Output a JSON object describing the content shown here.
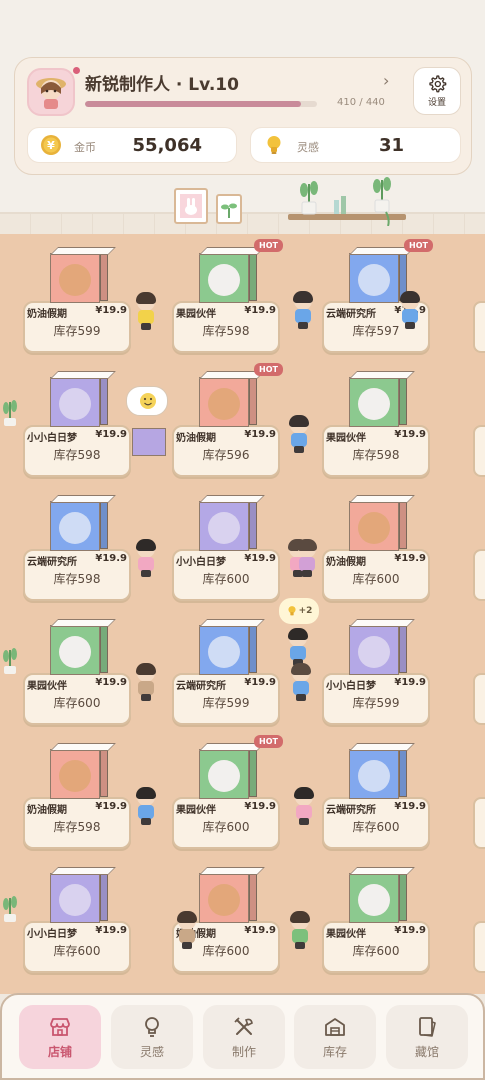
{
  "player": {
    "name": "新锐制作人 · Lv.10",
    "xp_text": "410 / 440",
    "xp_fraction": 0.932
  },
  "settings_label": "设置",
  "stats": {
    "coin_label": "金币",
    "coin_value": "55,064",
    "idea_label": "灵感",
    "idea_value": "31"
  },
  "idea_popup": "+2",
  "stock_prefix": "库存",
  "hot_label": "HOT",
  "colors": {
    "pink": "#f2a99a",
    "purple": "#b4a8e6",
    "green": "#8cc98f",
    "blue": "#82a8ee"
  },
  "shelves": [
    [
      {
        "name": "奶油假期",
        "price": "¥19.9",
        "stock": "库存599",
        "color": "pink",
        "hot": false
      },
      {
        "name": "果园伙伴",
        "price": "¥19.9",
        "stock": "库存598",
        "color": "green",
        "hot": true
      },
      {
        "name": "云端研究所",
        "price": "¥19.9",
        "stock": "库存597",
        "color": "blue",
        "hot": true
      }
    ],
    [
      {
        "name": "小小白日梦",
        "price": "¥19.9",
        "stock": "库存598",
        "color": "purple",
        "hot": false
      },
      {
        "name": "奶油假期",
        "price": "¥19.9",
        "stock": "库存596",
        "color": "pink",
        "hot": true
      },
      {
        "name": "果园伙伴",
        "price": "¥19.9",
        "stock": "库存598",
        "color": "green",
        "hot": false
      }
    ],
    [
      {
        "name": "云端研究所",
        "price": "¥19.9",
        "stock": "库存598",
        "color": "blue",
        "hot": false
      },
      {
        "name": "小小白日梦",
        "price": "¥19.9",
        "stock": "库存600",
        "color": "purple",
        "hot": false
      },
      {
        "name": "奶油假期",
        "price": "¥19.9",
        "stock": "库存600",
        "color": "pink",
        "hot": false
      }
    ],
    [
      {
        "name": "果园伙伴",
        "price": "¥19.9",
        "stock": "库存600",
        "color": "green",
        "hot": false
      },
      {
        "name": "云端研究所",
        "price": "¥19.9",
        "stock": "库存599",
        "color": "blue",
        "hot": false
      },
      {
        "name": "小小白日梦",
        "price": "¥19.9",
        "stock": "库存599",
        "color": "purple",
        "hot": false
      }
    ],
    [
      {
        "name": "奶油假期",
        "price": "¥19.9",
        "stock": "库存598",
        "color": "pink",
        "hot": false
      },
      {
        "name": "果园伙伴",
        "price": "¥19.9",
        "stock": "库存600",
        "color": "green",
        "hot": true
      },
      {
        "name": "云端研究所",
        "price": "¥19.9",
        "stock": "库存600",
        "color": "blue",
        "hot": false
      }
    ],
    [
      {
        "name": "小小白日梦",
        "price": "¥19.9",
        "stock": "库存600",
        "color": "purple",
        "hot": false
      },
      {
        "name": "奶油假期",
        "price": "¥19.9",
        "stock": "库存600",
        "color": "pink",
        "hot": false
      },
      {
        "name": "果园伙伴",
        "price": "¥19.9",
        "stock": "库存600",
        "color": "green",
        "hot": false
      }
    ]
  ],
  "nav": [
    {
      "label": "店铺",
      "icon": "shop-icon",
      "active": true
    },
    {
      "label": "灵感",
      "icon": "idea-icon",
      "active": false
    },
    {
      "label": "制作",
      "icon": "tools-icon",
      "active": false
    },
    {
      "label": "库存",
      "icon": "warehouse-icon",
      "active": false
    },
    {
      "label": "藏馆",
      "icon": "collection-icon",
      "active": false
    }
  ]
}
